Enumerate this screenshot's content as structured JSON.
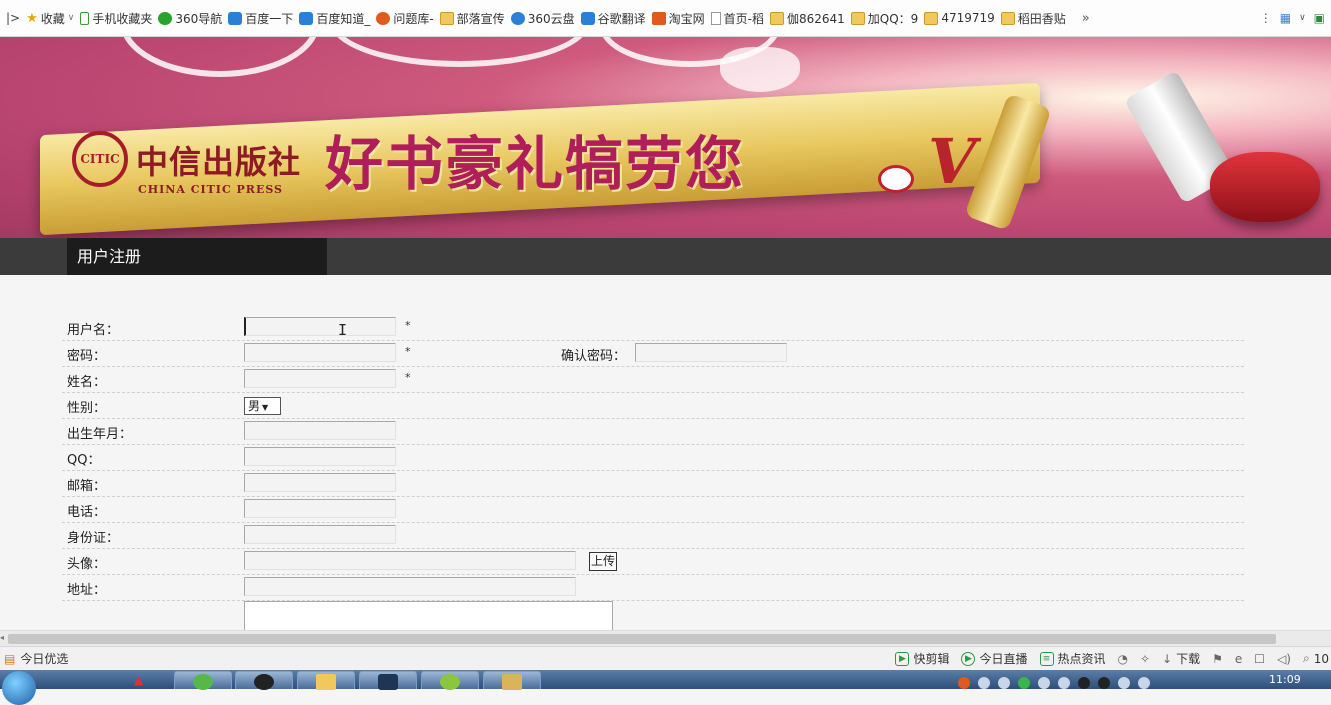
{
  "bookmarks": {
    "items": [
      {
        "label": "收藏",
        "icon": "star-icon"
      },
      {
        "label": "手机收藏夹",
        "icon": "phone-icon"
      },
      {
        "label": "360导航",
        "icon": "nav360-icon"
      },
      {
        "label": "百度一下",
        "icon": "baidu-icon"
      },
      {
        "label": "百度知道_",
        "icon": "baidu-icon"
      },
      {
        "label": "问题库-",
        "icon": "sogou-icon"
      },
      {
        "label": "部落宣传",
        "icon": "folder-icon"
      },
      {
        "label": "360云盘",
        "icon": "cloud-icon"
      },
      {
        "label": "谷歌翻译",
        "icon": "translate-icon"
      },
      {
        "label": "淘宝网",
        "icon": "taobao-icon"
      },
      {
        "label": "首页-稻",
        "icon": "page-icon"
      },
      {
        "label": "伽862641",
        "icon": "folder-icon"
      },
      {
        "label": "加QQ：9",
        "icon": "folder-icon"
      },
      {
        "label": "4719719",
        "icon": "folder-icon"
      },
      {
        "label": "稻田香贴",
        "icon": "folder-icon"
      }
    ],
    "more": "»"
  },
  "banner": {
    "logo_mark": "CITIC",
    "press_cn": "中信出版社",
    "press_en": "CHINA CITIC PRESS",
    "slogan": "好书豪礼犒劳您",
    "v_mark": "V"
  },
  "nav": {
    "active_tab": "用户注册"
  },
  "form": {
    "username_label": "用户名：",
    "password_label": "密码：",
    "confirm_password_label": "确认密码：",
    "realname_label": "姓名：",
    "gender_label": "性别：",
    "gender_value": "男",
    "birthday_label": "出生年月：",
    "qq_label": "QQ：",
    "email_label": "邮箱：",
    "phone_label": "电话：",
    "idcard_label": "身份证：",
    "avatar_label": "头像：",
    "upload_label": "上传",
    "address_label": "地址：",
    "required_mark": "*"
  },
  "statusbar": {
    "left": "今日优选",
    "items": [
      "快剪辑",
      "今日直播",
      "热点资讯",
      "下载"
    ],
    "zoom": "10"
  },
  "taskbar": {
    "clock": "11:09"
  }
}
